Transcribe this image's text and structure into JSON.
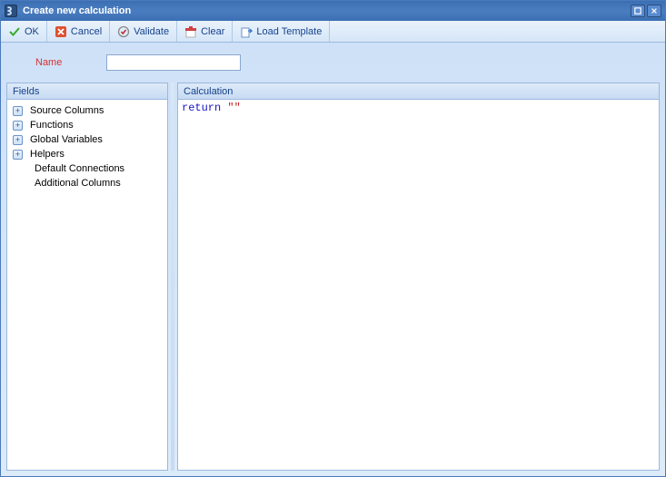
{
  "title": "Create new calculation",
  "toolbar": {
    "ok": "OK",
    "cancel": "Cancel",
    "validate": "Validate",
    "clear": "Clear",
    "load_template": "Load Template"
  },
  "name": {
    "label": "Name",
    "value": ""
  },
  "fields": {
    "header": "Fields",
    "items": [
      {
        "label": "Source Columns",
        "expandable": true
      },
      {
        "label": "Functions",
        "expandable": true
      },
      {
        "label": "Global Variables",
        "expandable": true
      },
      {
        "label": "Helpers",
        "expandable": true
      },
      {
        "label": "Default Connections",
        "expandable": false
      },
      {
        "label": "Additional Columns",
        "expandable": false
      }
    ]
  },
  "calculation": {
    "header": "Calculation",
    "code_keyword": "return",
    "code_string": " \"\""
  }
}
